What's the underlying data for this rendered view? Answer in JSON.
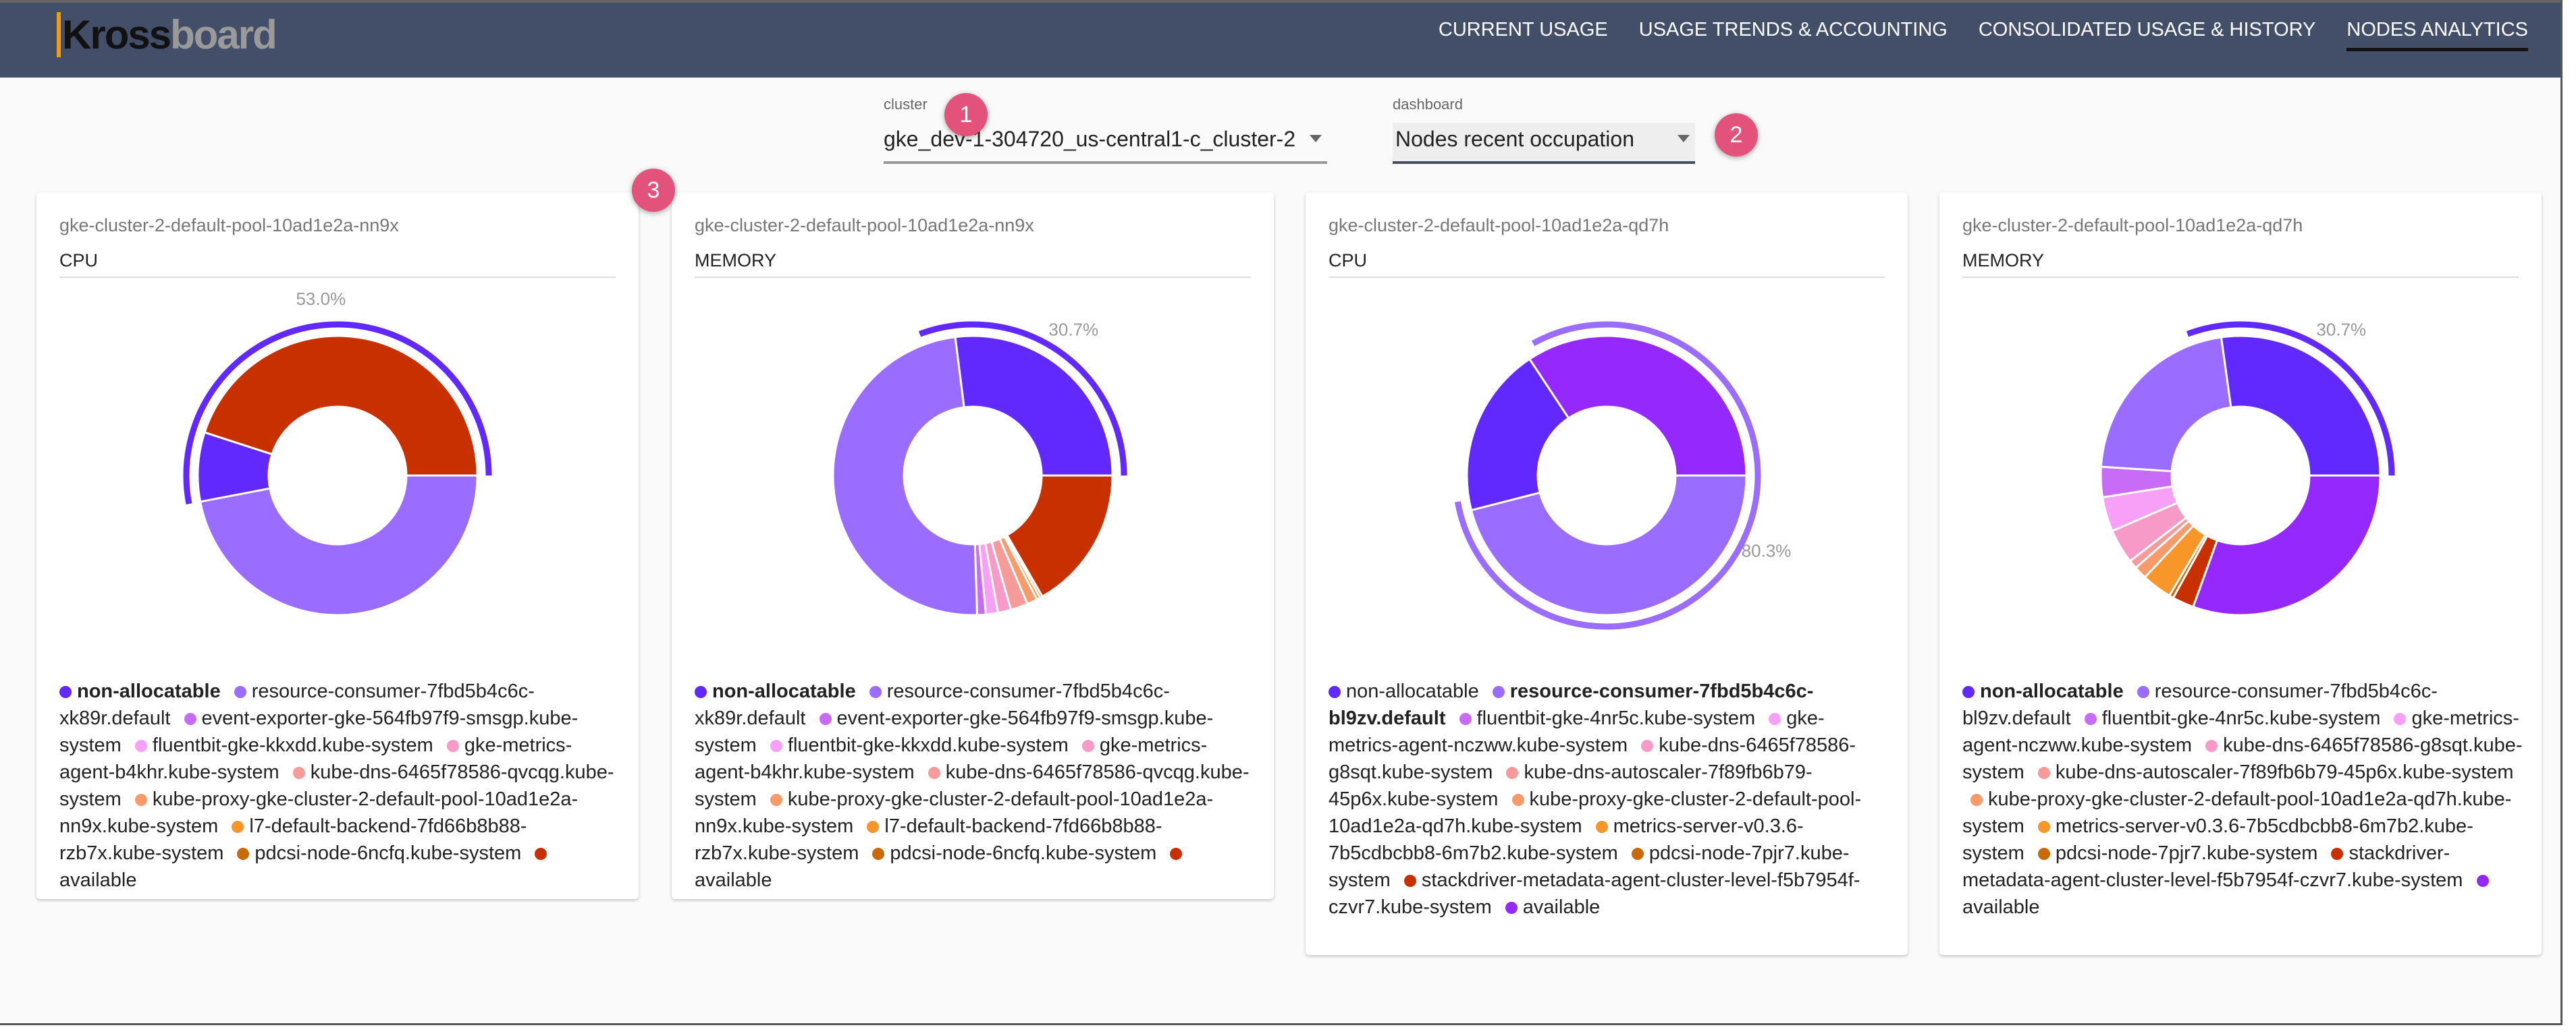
{
  "header": {
    "logo_text": "Krossboard",
    "nav": [
      {
        "label": "CURRENT USAGE",
        "active": false
      },
      {
        "label": "USAGE TRENDS & ACCOUNTING",
        "active": false
      },
      {
        "label": "CONSOLIDATED USAGE & HISTORY",
        "active": false
      },
      {
        "label": "NODES ANALYTICS",
        "active": true
      }
    ]
  },
  "filters": {
    "cluster": {
      "label": "cluster",
      "value": "gke_dev-1-304720_us-central1-c_cluster-2"
    },
    "dashboard": {
      "label": "dashboard",
      "value": "Nodes recent occupation"
    }
  },
  "badges": [
    "1",
    "2",
    "3"
  ],
  "chart_data": [
    {
      "type": "pie",
      "node": "gke-cluster-2-default-pool-10ad1e2a-nn9x",
      "title": "CPU",
      "highlight_label": "53.0%",
      "highlight_percent": 53.0,
      "slices": [
        {
          "name": "resource-consumer-7fbd5b4c6c-xk89r.default",
          "value": 47.0,
          "color": "#9a6cff"
        },
        {
          "name": "event-exporter-gke-564fb97f9-smsgp.kube-system",
          "value": 0,
          "color": "#c86cf8"
        },
        {
          "name": "fluentbit-gke-kkxdd.kube-system",
          "value": 0,
          "color": "#f8a0f8"
        },
        {
          "name": "gke-metrics-agent-b4khr.kube-system",
          "value": 0,
          "color": "#f79ac8"
        },
        {
          "name": "kube-dns-6465f78586-qvcqg.kube-system",
          "value": 0,
          "color": "#f79a9a"
        },
        {
          "name": "kube-proxy-gke-cluster-2-default-pool-10ad1e2a-nn9x.kube-system",
          "value": 0,
          "color": "#f89a6a"
        },
        {
          "name": "l7-default-backend-7fd66b8b88-rzb7x.kube-system",
          "value": 0,
          "color": "#f8962a"
        },
        {
          "name": "pdcsi-node-6ncfq.kube-system",
          "value": 0,
          "color": "#c86a0a"
        },
        {
          "name": "non-allocatable",
          "value": 8.0,
          "color": "#6229ff"
        },
        {
          "name": "available",
          "value": 45.0,
          "color": "#c83000"
        }
      ],
      "legend": [
        {
          "label": "non-allocatable",
          "color": "#6229ff",
          "bold": true
        },
        {
          "label": "resource-consumer-7fbd5b4c6c-xk89r.default",
          "color": "#9a6cff",
          "bold": false
        },
        {
          "label": "event-exporter-gke-564fb97f9-smsgp.kube-system",
          "color": "#c86cf8",
          "bold": false
        },
        {
          "label": "fluentbit-gke-kkxdd.kube-system",
          "color": "#f8a0f8",
          "bold": false
        },
        {
          "label": "gke-metrics-agent-b4khr.kube-system",
          "color": "#f79ac8",
          "bold": false
        },
        {
          "label": "kube-dns-6465f78586-qvcqg.kube-system",
          "color": "#f79a9a",
          "bold": false
        },
        {
          "label": "kube-proxy-gke-cluster-2-default-pool-10ad1e2a-nn9x.kube-system",
          "color": "#f89a6a",
          "bold": false
        },
        {
          "label": "l7-default-backend-7fd66b8b88-rzb7x.kube-system",
          "color": "#f8962a",
          "bold": false
        },
        {
          "label": "pdcsi-node-6ncfq.kube-system",
          "color": "#c86a0a",
          "bold": false
        },
        {
          "label": "available",
          "color": "#c83000",
          "bold": false
        }
      ]
    },
    {
      "type": "pie",
      "node": "gke-cluster-2-default-pool-10ad1e2a-nn9x",
      "title": "MEMORY",
      "highlight_label": "30.7%",
      "highlight_percent": 30.7,
      "slices": [
        {
          "name": "available",
          "value": 16.7,
          "color": "#c83000"
        },
        {
          "name": "pdcsi-node-6ncfq.kube-system",
          "value": 0.3,
          "color": "#c86a0a"
        },
        {
          "name": "l7-default-backend-7fd66b8b88-rzb7x.kube-system",
          "value": 0.4,
          "color": "#f8962a"
        },
        {
          "name": "kube-proxy-gke-cluster-2-default-pool-10ad1e2a-nn9x.kube-system",
          "value": 1.2,
          "color": "#f89a6a"
        },
        {
          "name": "kube-dns-6465f78586-qvcqg.kube-system",
          "value": 2.0,
          "color": "#f79a9a"
        },
        {
          "name": "gke-metrics-agent-b4khr.kube-system",
          "value": 1.5,
          "color": "#f79ac8"
        },
        {
          "name": "fluentbit-gke-kkxdd.kube-system",
          "value": 1.4,
          "color": "#f8a0f8"
        },
        {
          "name": "event-exporter-gke-564fb97f9-smsgp.kube-system",
          "value": 1.0,
          "color": "#c86cf8"
        },
        {
          "name": "resource-consumer-7fbd5b4c6c-xk89r.default",
          "value": 48.5,
          "color": "#9a6cff"
        },
        {
          "name": "non-allocatable",
          "value": 27.0,
          "color": "#6229ff"
        }
      ],
      "legend": [
        {
          "label": "non-allocatable",
          "color": "#6229ff",
          "bold": true
        },
        {
          "label": "resource-consumer-7fbd5b4c6c-xk89r.default",
          "color": "#9a6cff",
          "bold": false
        },
        {
          "label": "event-exporter-gke-564fb97f9-smsgp.kube-system",
          "color": "#c86cf8",
          "bold": false
        },
        {
          "label": "fluentbit-gke-kkxdd.kube-system",
          "color": "#f8a0f8",
          "bold": false
        },
        {
          "label": "gke-metrics-agent-b4khr.kube-system",
          "color": "#f79ac8",
          "bold": false
        },
        {
          "label": "kube-dns-6465f78586-qvcqg.kube-system",
          "color": "#f79a9a",
          "bold": false
        },
        {
          "label": "kube-proxy-gke-cluster-2-default-pool-10ad1e2a-nn9x.kube-system",
          "color": "#f89a6a",
          "bold": false
        },
        {
          "label": "l7-default-backend-7fd66b8b88-rzb7x.kube-system",
          "color": "#f8962a",
          "bold": false
        },
        {
          "label": "pdcsi-node-6ncfq.kube-system",
          "color": "#c86a0a",
          "bold": false
        },
        {
          "label": "available",
          "color": "#c83000",
          "bold": false
        }
      ]
    },
    {
      "type": "pie",
      "node": "gke-cluster-2-default-pool-10ad1e2a-qd7h",
      "title": "CPU",
      "highlight_label": "80.3%",
      "highlight_percent": 80.3,
      "slices": [
        {
          "name": "resource-consumer-7fbd5b4c6c-bl9zv.default",
          "value": 46.0,
          "color": "#9a6cff"
        },
        {
          "name": "non-allocatable",
          "value": 19.7,
          "color": "#6229ff"
        },
        {
          "name": "available",
          "value": 34.3,
          "color": "#9529fd"
        }
      ],
      "legend": [
        {
          "label": "non-allocatable",
          "color": "#6229ff",
          "bold": false
        },
        {
          "label": "resource-consumer-7fbd5b4c6c-bl9zv.default",
          "color": "#9a6cff",
          "bold": true
        },
        {
          "label": "fluentbit-gke-4nr5c.kube-system",
          "color": "#c86cf8",
          "bold": false
        },
        {
          "label": "gke-metrics-agent-nczww.kube-system",
          "color": "#f8a0f8",
          "bold": false
        },
        {
          "label": "kube-dns-6465f78586-g8sqt.kube-system",
          "color": "#f79ac8",
          "bold": false
        },
        {
          "label": "kube-dns-autoscaler-7f89fb6b79-45p6x.kube-system",
          "color": "#f79a9a",
          "bold": false
        },
        {
          "label": "kube-proxy-gke-cluster-2-default-pool-10ad1e2a-qd7h.kube-system",
          "color": "#f89a6a",
          "bold": false
        },
        {
          "label": "metrics-server-v0.3.6-7b5cdbcbb8-6m7b2.kube-system",
          "color": "#f8962a",
          "bold": false
        },
        {
          "label": "pdcsi-node-7pjr7.kube-system",
          "color": "#c86a0a",
          "bold": false
        },
        {
          "label": "stackdriver-metadata-agent-cluster-level-f5b7954f-czvr7.kube-system",
          "color": "#c83000",
          "bold": false
        },
        {
          "label": "available",
          "color": "#9529fd",
          "bold": false
        }
      ]
    },
    {
      "type": "pie",
      "node": "gke-cluster-2-default-pool-10ad1e2a-qd7h",
      "title": "MEMORY",
      "highlight_label": "30.7%",
      "highlight_percent": 30.7,
      "slices": [
        {
          "name": "available",
          "value": 30.5,
          "color": "#9529fd"
        },
        {
          "name": "stackdriver-metadata-agent-cluster-level-f5b7954f-czvr7.kube-system",
          "value": 2.5,
          "color": "#c83000"
        },
        {
          "name": "pdcsi-node-7pjr7.kube-system",
          "value": 0.5,
          "color": "#c86a0a"
        },
        {
          "name": "metrics-server-v0.3.6-7b5cdbcbb8-6m7b2.kube-system",
          "value": 3.5,
          "color": "#f8962a"
        },
        {
          "name": "kube-proxy-gke-cluster-2-default-pool-10ad1e2a-qd7h.kube-system",
          "value": 1.5,
          "color": "#f89a6a"
        },
        {
          "name": "kube-dns-autoscaler-7f89fb6b79-45p6x.kube-system",
          "value": 1.0,
          "color": "#f79a9a"
        },
        {
          "name": "kube-dns-6465f78586-g8sqt.kube-system",
          "value": 4.0,
          "color": "#f79ac8"
        },
        {
          "name": "gke-metrics-agent-nczww.kube-system",
          "value": 4.0,
          "color": "#f8a0f8"
        },
        {
          "name": "fluentbit-gke-4nr5c.kube-system",
          "value": 3.5,
          "color": "#c86cf8"
        },
        {
          "name": "resource-consumer-7fbd5b4c6c-bl9zv.default",
          "value": 21.8,
          "color": "#9a6cff"
        },
        {
          "name": "non-allocatable",
          "value": 27.2,
          "color": "#6229ff"
        }
      ],
      "legend": [
        {
          "label": "non-allocatable",
          "color": "#6229ff",
          "bold": true
        },
        {
          "label": "resource-consumer-7fbd5b4c6c-bl9zv.default",
          "color": "#9a6cff",
          "bold": false
        },
        {
          "label": "fluentbit-gke-4nr5c.kube-system",
          "color": "#c86cf8",
          "bold": false
        },
        {
          "label": "gke-metrics-agent-nczww.kube-system",
          "color": "#f8a0f8",
          "bold": false
        },
        {
          "label": "kube-dns-6465f78586-g8sqt.kube-system",
          "color": "#f79ac8",
          "bold": false
        },
        {
          "label": "kube-dns-autoscaler-7f89fb6b79-45p6x.kube-system",
          "color": "#f79a9a",
          "bold": false
        },
        {
          "label": "kube-proxy-gke-cluster-2-default-pool-10ad1e2a-qd7h.kube-system",
          "color": "#f89a6a",
          "bold": false
        },
        {
          "label": "metrics-server-v0.3.6-7b5cdbcbb8-6m7b2.kube-system",
          "color": "#f8962a",
          "bold": false
        },
        {
          "label": "pdcsi-node-7pjr7.kube-system",
          "color": "#c86a0a",
          "bold": false
        },
        {
          "label": "stackdriver-metadata-agent-cluster-level-f5b7954f-czvr7.kube-system",
          "color": "#c83000",
          "bold": false
        },
        {
          "label": "available",
          "color": "#9529fd",
          "bold": false
        }
      ]
    }
  ]
}
